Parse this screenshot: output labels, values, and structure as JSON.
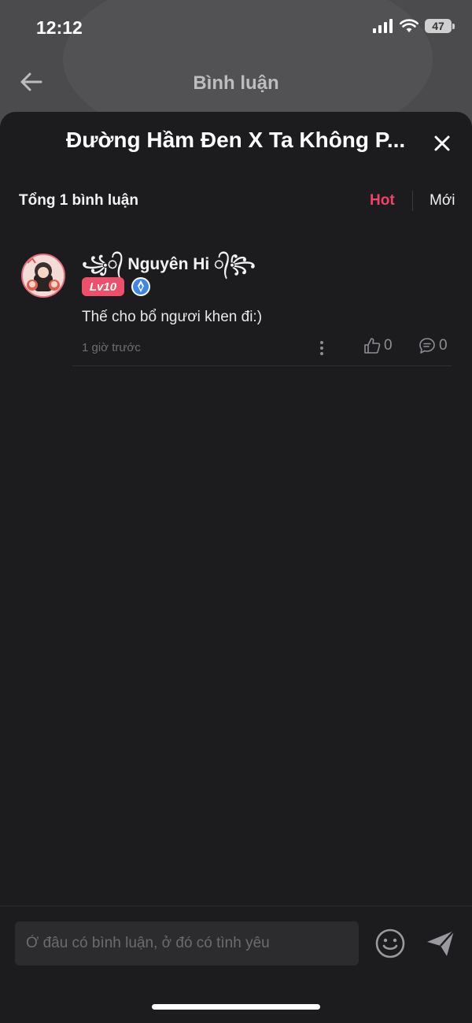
{
  "status_bar": {
    "time": "12:12",
    "battery": "47"
  },
  "page": {
    "title": "Bình luận"
  },
  "sheet": {
    "title": "Đường Hầm Đen X Ta Không P...",
    "comment_count": "Tổng 1 bình luận",
    "sort_hot": "Hot",
    "sort_new": "Mới"
  },
  "comments": [
    {
      "username": "꧁᭄ Nguyên Hi ᭄꧂",
      "level": "Lv10",
      "text": "Thế cho bổ ngươi khen đi:)",
      "time": "1 giờ trước",
      "likes": "0",
      "replies": "0"
    }
  ],
  "composer": {
    "placeholder": "Ở đâu có bình luận, ở đó có tình yêu"
  },
  "colors": {
    "accent": "#f0436a",
    "sheet_bg": "#1c1c1e",
    "level_badge": "#ee4f6b"
  }
}
